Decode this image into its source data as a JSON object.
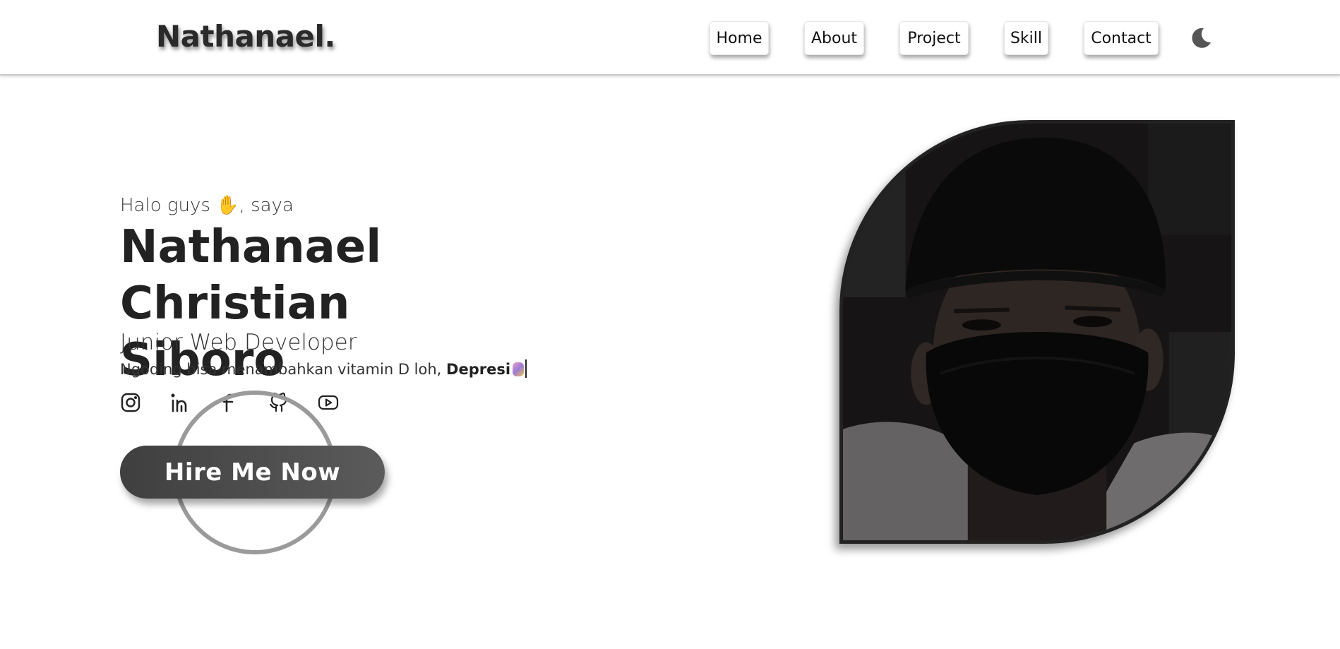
{
  "header": {
    "logo": "Nathanael.",
    "nav": [
      {
        "label": "Home"
      },
      {
        "label": "About"
      },
      {
        "label": "Project"
      },
      {
        "label": "Skill"
      },
      {
        "label": "Contact"
      }
    ],
    "theme_toggle_icon": "moon-icon"
  },
  "hero": {
    "greeting_prefix": "Halo guys",
    "greeting_emoji": "✋",
    "greeting_suffix": ", saya",
    "name_line1": "Nathanael Christian",
    "name_line2": "Siboro",
    "role": "Junior Web Developer",
    "tagline_prefix": "Ngoding bisa menambahkan vitamin D loh,",
    "tagline_typed": "Depresi",
    "socials": [
      {
        "icon": "instagram-icon"
      },
      {
        "icon": "linkedin-icon"
      },
      {
        "icon": "facebook-icon"
      },
      {
        "icon": "github-icon"
      },
      {
        "icon": "youtube-icon"
      }
    ],
    "cta_label": "Hire Me Now"
  },
  "colors": {
    "text": "#222222",
    "button_gradient_start": "#3f3f3f",
    "button_gradient_end": "#5b5b5b",
    "ring": "#9a9a9a",
    "hand_emoji": "#f2b530"
  }
}
